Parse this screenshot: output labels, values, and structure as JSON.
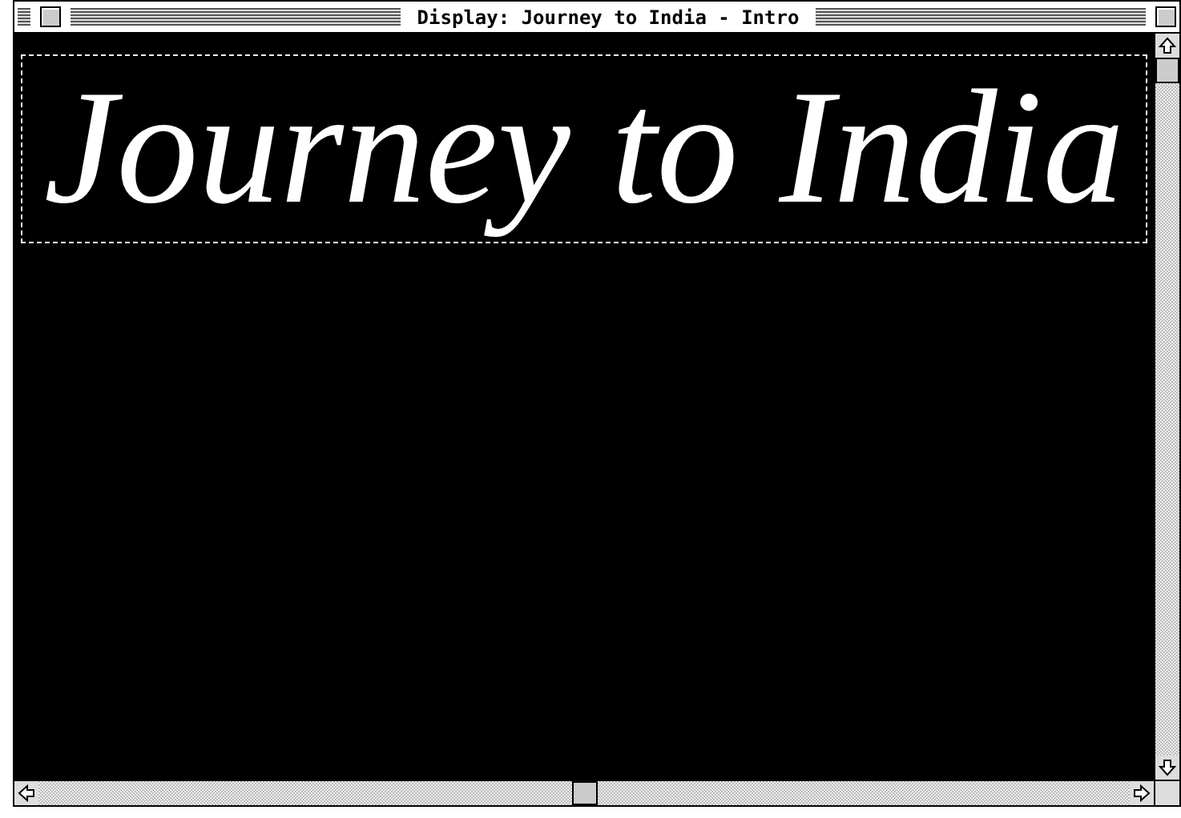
{
  "window": {
    "title": "Display: Journey to India - Intro"
  },
  "title_card": {
    "text": "Journey to India",
    "selected": true
  }
}
